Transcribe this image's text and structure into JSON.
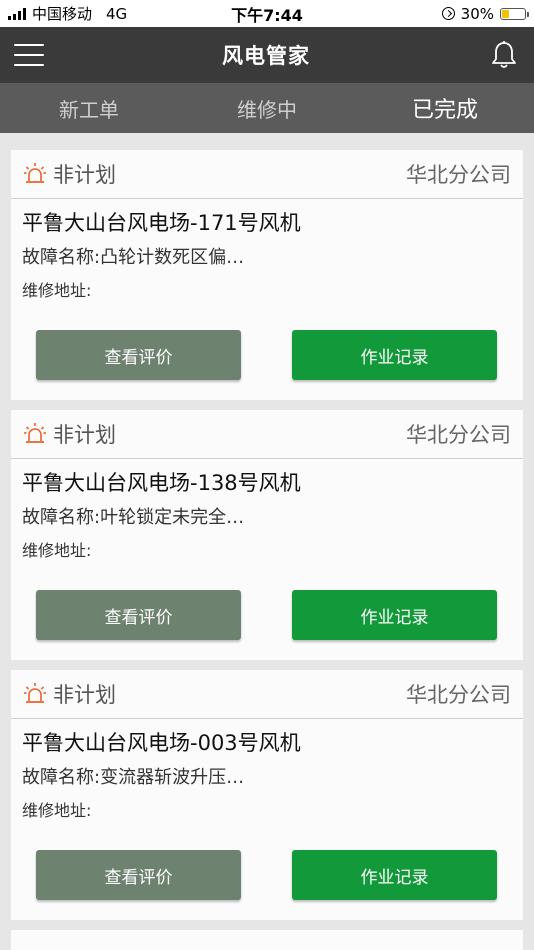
{
  "status_bar": {
    "carrier": "中国移动",
    "network": "4G",
    "time": "下午7:44",
    "battery_percent": "30%",
    "battery_level": 0.3
  },
  "header": {
    "title": "风电管家",
    "menu_icon": "hamburger-menu-icon",
    "bell_icon": "bell-icon"
  },
  "tabs": [
    {
      "label": "新工单",
      "active": false
    },
    {
      "label": "维修中",
      "active": false
    },
    {
      "label": "已完成",
      "active": true
    }
  ],
  "orders": [
    {
      "type": "非计划",
      "company": "华北分公司",
      "title": "平鲁大山台风电场-171号风机",
      "fault": "故障名称:凸轮计数死区偏…",
      "address": "维修地址:",
      "review_label": "查看评价",
      "record_label": "作业记录"
    },
    {
      "type": "非计划",
      "company": "华北分公司",
      "title": "平鲁大山台风电场-138号风机",
      "fault": "故障名称:叶轮锁定未完全…",
      "address": "维修地址:",
      "review_label": "查看评价",
      "record_label": "作业记录"
    },
    {
      "type": "非计划",
      "company": "华北分公司",
      "title": "平鲁大山台风电场-003号风机",
      "fault": "故障名称:变流器斩波升压…",
      "address": "维修地址:",
      "review_label": "查看评价",
      "record_label": "作业记录"
    }
  ],
  "colors": {
    "nav_bg": "#3a3a3a",
    "tab_bg": "#5b5b5b",
    "review_button": "#6e8270",
    "record_button": "#129a3a",
    "alarm_icon": "#e8622c"
  }
}
